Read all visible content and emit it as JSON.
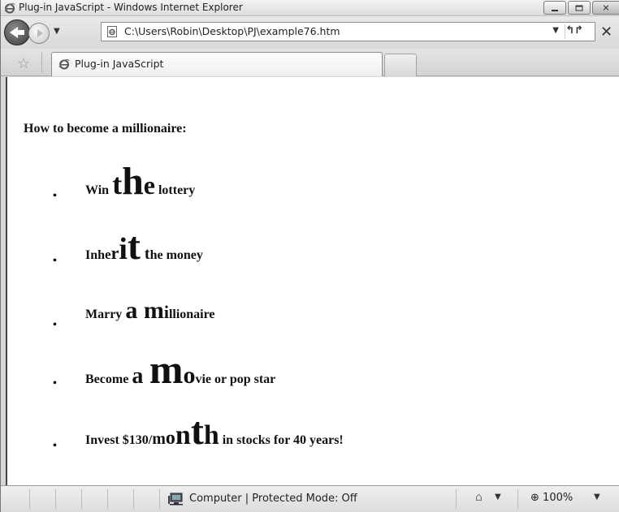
{
  "window": {
    "title": "Plug-in JavaScript - Windows Internet Explorer"
  },
  "address_bar": {
    "url": "C:\\Users\\Robin\\Desktop\\PJ\\example76.htm"
  },
  "tabs": [
    {
      "label": "Plug-in JavaScript"
    }
  ],
  "page": {
    "intro": "How to become a millionaire:",
    "items": [
      {
        "bullet": "•",
        "segments": [
          {
            "text": "Win ",
            "size": 16
          },
          {
            "text": "t",
            "size": 36
          },
          {
            "text": "h",
            "size": 48
          },
          {
            "text": "e",
            "size": 32
          },
          {
            "text": " lottery",
            "size": 16
          }
        ]
      },
      {
        "bullet": "•",
        "segments": [
          {
            "text": "Inh",
            "size": 16
          },
          {
            "text": "e",
            "size": 17
          },
          {
            "text": "r",
            "size": 22
          },
          {
            "text": "i",
            "size": 38
          },
          {
            "text": "t",
            "size": 48
          },
          {
            "text": " t",
            "size": 20
          },
          {
            "text": "he money",
            "size": 16
          }
        ]
      },
      {
        "bullet": "•",
        "segments": [
          {
            "text": "Marry ",
            "size": 16
          },
          {
            "text": "a",
            "size": 30
          },
          {
            "text": " ",
            "size": 30
          },
          {
            "text": "m",
            "size": 30
          },
          {
            "text": "i",
            "size": 22
          },
          {
            "text": "llionaire",
            "size": 16
          }
        ]
      },
      {
        "bullet": "•",
        "segments": [
          {
            "text": "Become ",
            "size": 16
          },
          {
            "text": "a",
            "size": 28
          },
          {
            "text": " ",
            "size": 30
          },
          {
            "text": "m",
            "size": 50
          },
          {
            "text": "o",
            "size": 30
          },
          {
            "text": "vie or pop star",
            "size": 16
          }
        ]
      },
      {
        "bullet": "•",
        "segments": [
          {
            "text": "Invest $130/",
            "size": 16
          },
          {
            "text": "m",
            "size": 20
          },
          {
            "text": "o",
            "size": 24
          },
          {
            "text": "n",
            "size": 34
          },
          {
            "text": "t",
            "size": 48
          },
          {
            "text": "h",
            "size": 34
          },
          {
            "text": " in stocks for 40 years!",
            "size": 16
          }
        ]
      }
    ]
  },
  "status_bar": {
    "zone_text": "Computer | Protected Mode: Off",
    "zoom": "100%"
  },
  "icons": {
    "back": "back-arrow-icon",
    "forward": "forward-arrow-icon",
    "refresh": "refresh-icon",
    "stop": "close-icon",
    "favorites": "star-icon"
  }
}
